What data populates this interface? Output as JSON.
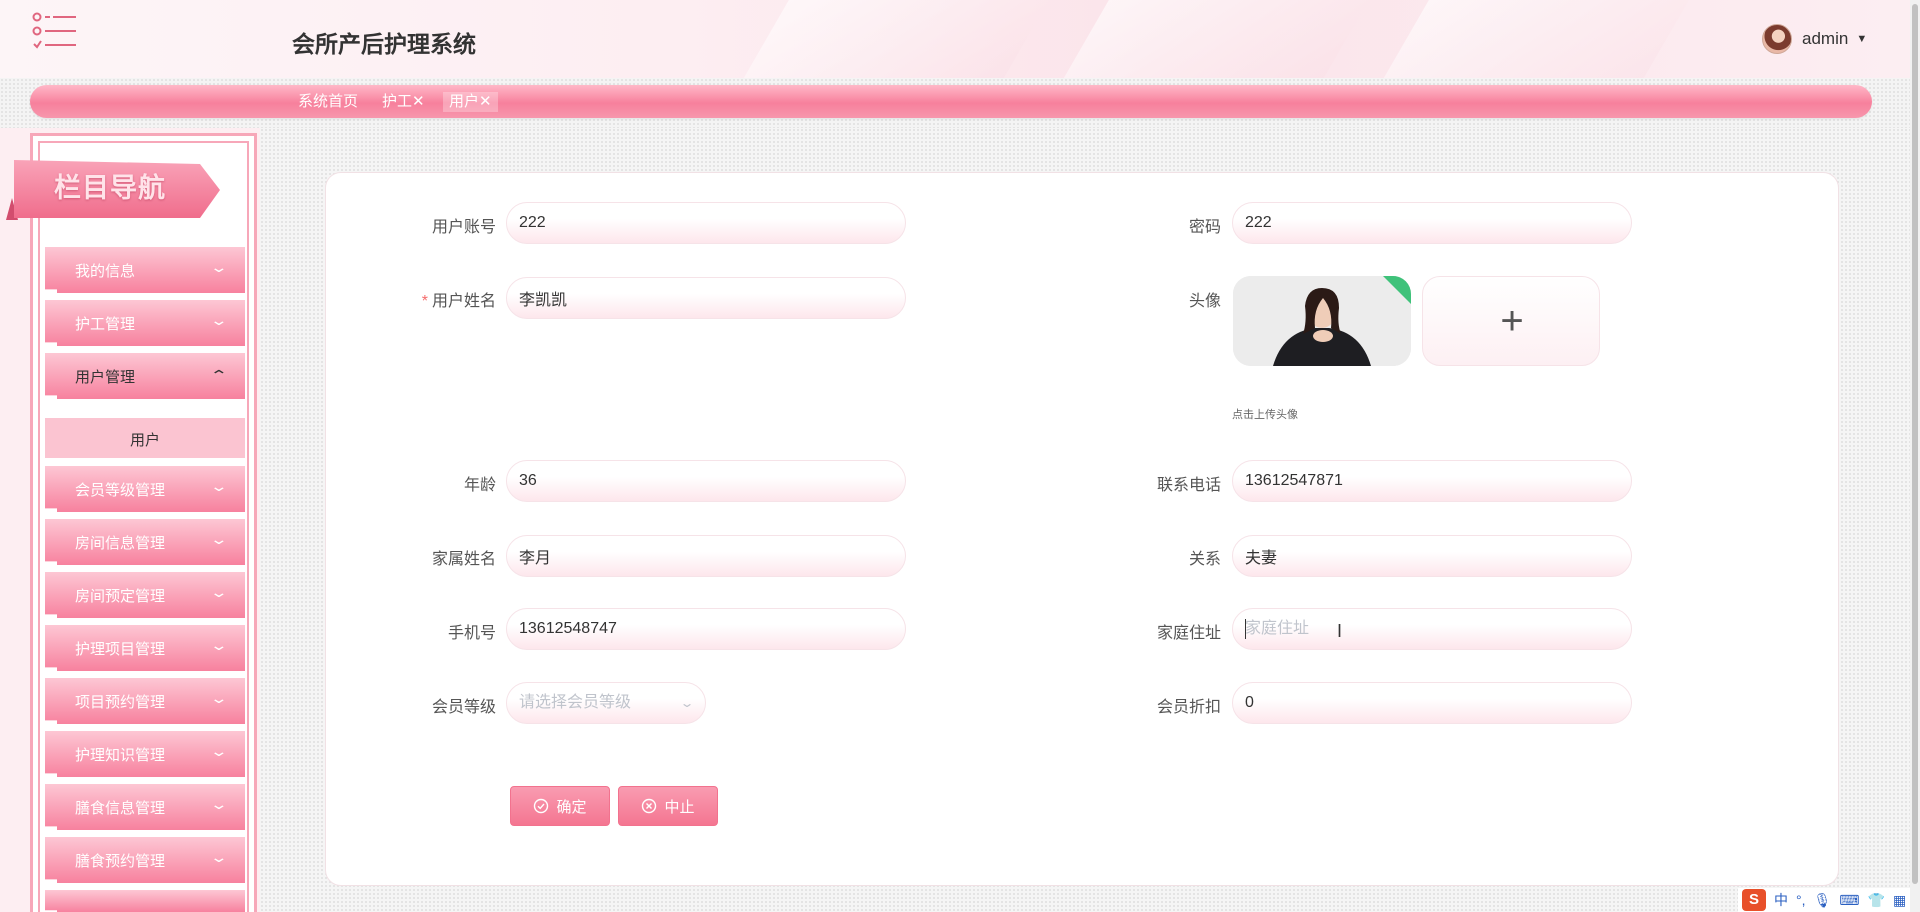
{
  "app": {
    "title": "会所产后护理系统"
  },
  "user": {
    "name": "admin"
  },
  "tabs": [
    {
      "label": "系统首页"
    },
    {
      "label": "护工✕"
    },
    {
      "label": "用户✕"
    }
  ],
  "sidebar": {
    "heading": "栏目导航",
    "items": [
      {
        "label": "我的信息"
      },
      {
        "label": "护工管理"
      },
      {
        "label": "用户管理"
      },
      {
        "label": "会员等级管理"
      },
      {
        "label": "房间信息管理"
      },
      {
        "label": "房间预定管理"
      },
      {
        "label": "护理项目管理"
      },
      {
        "label": "项目预约管理"
      },
      {
        "label": "护理知识管理"
      },
      {
        "label": "膳食信息管理"
      },
      {
        "label": "膳食预约管理"
      }
    ],
    "sub_item": "用户"
  },
  "form": {
    "account": {
      "label": "用户账号",
      "value": "222"
    },
    "password": {
      "label": "密码",
      "value": "222"
    },
    "name": {
      "label": "用户姓名",
      "required_mark": "*",
      "value": "李凯凯"
    },
    "avatar": {
      "label": "头像",
      "hint": "点击上传头像",
      "plus": "+"
    },
    "age": {
      "label": "年龄",
      "value": "36"
    },
    "phone": {
      "label": "联系电话",
      "value": "13612547871"
    },
    "family_name": {
      "label": "家属姓名",
      "value": "李月"
    },
    "relation": {
      "label": "关系",
      "value": "夫妻"
    },
    "mobile": {
      "label": "手机号",
      "value": "13612548747"
    },
    "address": {
      "label": "家庭住址",
      "value": "",
      "placeholder": "家庭住址"
    },
    "member_level": {
      "label": "会员等级",
      "value": "",
      "placeholder": "请选择会员等级"
    },
    "discount": {
      "label": "会员折扣",
      "value": "0"
    }
  },
  "buttons": {
    "confirm": "确定",
    "cancel": "中止"
  },
  "tray": {
    "ime": "S",
    "lang": "中"
  },
  "colors": {
    "accent": "#f47691",
    "accent_light": "#fbc4d1",
    "required": "#f56c6c"
  }
}
